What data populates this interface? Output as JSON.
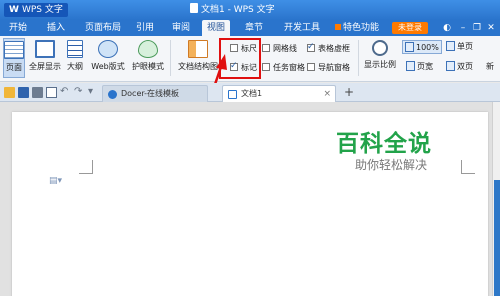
{
  "title_bar": {
    "app_name": "WPS 文字",
    "doc_title": "文档1 - WPS 文字"
  },
  "menu": {
    "tabs": [
      "开始",
      "插入",
      "页面布局",
      "引用",
      "审阅",
      "视图",
      "章节",
      "开发工具",
      "特色功能"
    ],
    "active_tab": "视图",
    "login": "未登录"
  },
  "ribbon": {
    "buttons": {
      "page_view": "页面",
      "fullscreen": "全屏显示",
      "outline": "大纲",
      "web_layout": "Web版式",
      "eye_mode": "护眼模式",
      "doc_map": "文档结构图"
    },
    "checkboxes": {
      "ruler": {
        "label": "标尺",
        "checked": false
      },
      "gridlines": {
        "label": "网格线",
        "checked": false
      },
      "table_gridlines": {
        "label": "表格虚框",
        "checked": true
      },
      "marks": {
        "label": "标记",
        "checked": true
      },
      "task_pane": {
        "label": "任务窗格",
        "checked": false
      },
      "nav_pane": {
        "label": "导航窗格",
        "checked": false
      }
    },
    "zoom": {
      "display_ratio": "显示比例",
      "percent": "100%",
      "single_page": "单页",
      "page_width": "页宽",
      "two_pages": "双页",
      "new_more": "新"
    }
  },
  "doc_tabs": [
    {
      "label": "Docer-在线模板",
      "active": false
    },
    {
      "label": "文档1",
      "active": true
    }
  ],
  "document": {
    "watermark_title": "百科全说",
    "watermark_sub": "助你轻松解决"
  },
  "colors": {
    "accent_blue": "#2a74cc",
    "login_orange": "#ff7a00",
    "highlight_red": "#e01010",
    "watermark_green": "#22a34a"
  }
}
